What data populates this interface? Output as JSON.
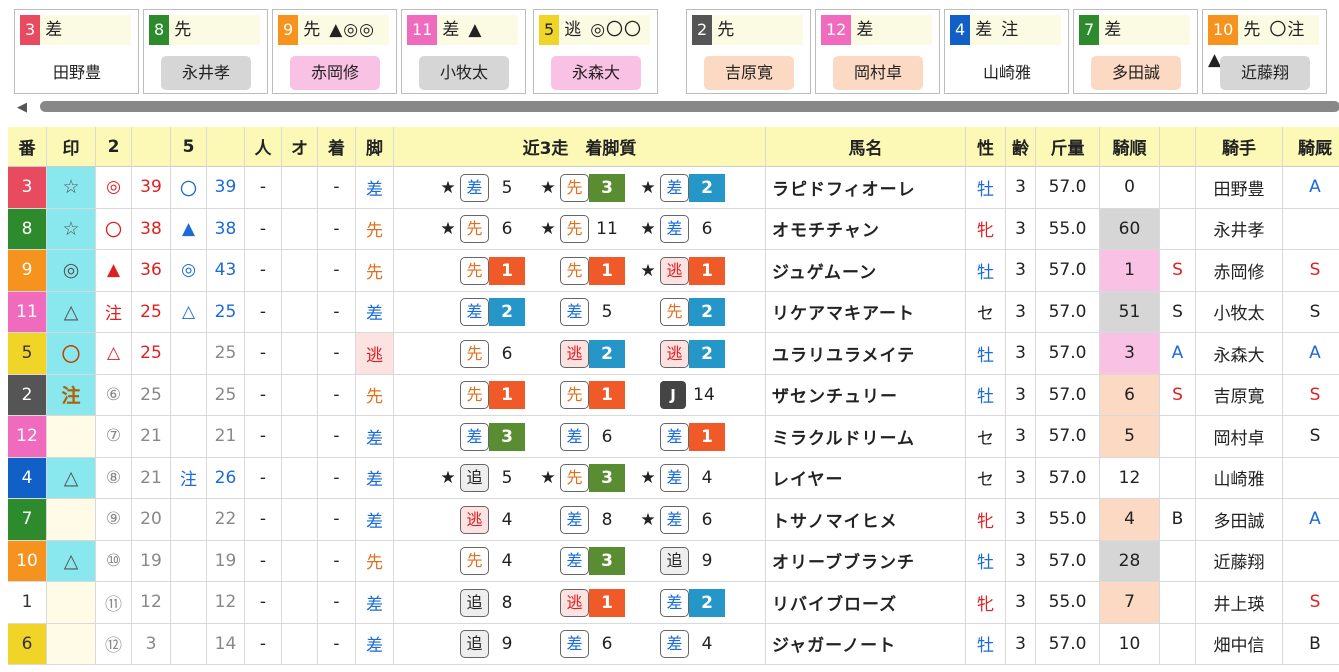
{
  "colors": {
    "w1": "#e84a5f",
    "w2": "#222222",
    "w3": "#e84a5f",
    "w4": "#1060c8",
    "w5": "#f0d428",
    "w6": "#f0d428",
    "w7": "#2d8a2d",
    "w8": "#2d8a2d",
    "w9": "#f5931e",
    "w10": "#f5931e",
    "w11": "#f06bbd",
    "w12": "#f06bbd",
    "gray": "#555555",
    "pink": "#f5a8d6",
    "peach": "#fcd9c2",
    "graybg": "#d6d6d6"
  },
  "cards": [
    {
      "num": "3",
      "style": "差",
      "marks": "",
      "jockey": "田野豊",
      "num_color": "#e84a5f",
      "jk_bg": "#ffffff"
    },
    {
      "num": "8",
      "style": "先",
      "marks": "",
      "jockey": "永井孝",
      "num_color": "#2d8a2d",
      "jk_bg": "#d6d6d6"
    },
    {
      "num": "9",
      "style": "先",
      "marks": "▲◎◎",
      "jockey": "赤岡修",
      "num_color": "#f5931e",
      "jk_bg": "#f9c2e4"
    },
    {
      "num": "11",
      "style": "差",
      "marks": "▲",
      "jockey": "小牧太",
      "num_color": "#f06bbd",
      "jk_bg": "#d6d6d6"
    },
    {
      "num": "5",
      "style": "逃",
      "marks": "◎〇〇",
      "jockey": "永森大",
      "num_color": "#f0d428",
      "jk_bg": "#f9c2e4"
    },
    {
      "num": "2",
      "style": "先",
      "marks": "",
      "jockey": "吉原寛",
      "num_color": "#555555",
      "jk_bg": "#fcd9c2"
    },
    {
      "num": "12",
      "style": "差",
      "marks": "",
      "jockey": "岡村卓",
      "num_color": "#f06bbd",
      "jk_bg": "#fcd9c2"
    },
    {
      "num": "4",
      "style": "差",
      "marks": "注",
      "jockey": "山崎雅",
      "num_color": "#1060c8",
      "jk_bg": "#ffffff"
    },
    {
      "num": "7",
      "style": "差",
      "marks": "",
      "jockey": "多田誠",
      "num_color": "#2d8a2d",
      "jk_bg": "#fcd9c2"
    },
    {
      "num": "10",
      "style": "先",
      "marks": "〇注▲",
      "jockey": "近藤翔",
      "num_color": "#f5931e",
      "jk_bg": "#d6d6d6"
    }
  ],
  "table": {
    "headers": [
      "番",
      "印",
      "2",
      "",
      "5",
      "",
      "人",
      "オ",
      "着",
      "脚",
      "近3走　着脚質",
      "馬名",
      "性",
      "齢",
      "斤量",
      "騎順",
      "",
      "騎手",
      "騎厩"
    ],
    "rows": [
      {
        "num": "3",
        "num_bg": "#e84a5f",
        "mark": "☆",
        "c2m": "◎",
        "c2v": "39",
        "c5m": "〇",
        "c5v": "39",
        "pop": "-",
        "odds": "",
        "fin": "-",
        "leg": "差",
        "leg_cls": "blue",
        "leg_bg": "",
        "runs": [
          {
            "star": "★",
            "st": "差",
            "sc": "b",
            "pos": "5",
            "pc": ""
          },
          {
            "star": "★",
            "st": "先",
            "sc": "o",
            "pos": "3",
            "pc": "p3"
          },
          {
            "star": "★",
            "st": "差",
            "sc": "b",
            "pos": "2",
            "pc": "p2"
          }
        ],
        "horse": "ラピドフィオーレ",
        "sex": "牡",
        "sex_cls": "blue",
        "age": "3",
        "wt": "57.0",
        "jr": "0",
        "jr_bg": "",
        "ja": "",
        "ja_cls": "",
        "jockey": "田野豊",
        "jk": "A",
        "jk_cls": "blue"
      },
      {
        "num": "8",
        "num_bg": "#2d8a2d",
        "mark": "☆",
        "c2m": "〇",
        "c2v": "38",
        "c5m": "▲",
        "c5v": "38",
        "pop": "-",
        "odds": "",
        "fin": "-",
        "leg": "先",
        "leg_cls": "orange",
        "leg_bg": "",
        "runs": [
          {
            "star": "★",
            "st": "先",
            "sc": "o",
            "pos": "6",
            "pc": ""
          },
          {
            "star": "★",
            "st": "先",
            "sc": "o",
            "pos": "11",
            "pc": ""
          },
          {
            "star": "★",
            "st": "差",
            "sc": "b",
            "pos": "6",
            "pc": ""
          }
        ],
        "horse": "オモチチャン",
        "sex": "牝",
        "sex_cls": "red",
        "age": "3",
        "wt": "55.0",
        "jr": "60",
        "jr_bg": "#d6d6d6",
        "ja": "",
        "ja_cls": "",
        "jockey": "永井孝",
        "jk": "",
        "jk_cls": ""
      },
      {
        "num": "9",
        "num_bg": "#f5931e",
        "mark": "◎",
        "c2m": "▲",
        "c2v": "36",
        "c5m": "◎",
        "c5v": "43",
        "pop": "-",
        "odds": "",
        "fin": "-",
        "leg": "先",
        "leg_cls": "orange",
        "leg_bg": "",
        "runs": [
          {
            "star": "",
            "st": "先",
            "sc": "o",
            "pos": "1",
            "pc": "p1"
          },
          {
            "star": "",
            "st": "先",
            "sc": "o",
            "pos": "1",
            "pc": "p1"
          },
          {
            "star": "★",
            "st": "逃",
            "sc": "r",
            "pos": "1",
            "pc": "p1"
          }
        ],
        "horse": "ジュゲムーン",
        "sex": "牡",
        "sex_cls": "blue",
        "age": "3",
        "wt": "57.0",
        "jr": "1",
        "jr_bg": "#f9c2e4",
        "ja": "S",
        "ja_cls": "red",
        "jockey": "赤岡修",
        "jk": "S",
        "jk_cls": "red"
      },
      {
        "num": "11",
        "num_bg": "#f06bbd",
        "mark": "△",
        "c2m": "注",
        "c2v": "25",
        "c5m": "△",
        "c5v": "25",
        "pop": "-",
        "odds": "",
        "fin": "-",
        "leg": "差",
        "leg_cls": "blue",
        "leg_bg": "",
        "runs": [
          {
            "star": "",
            "st": "差",
            "sc": "b",
            "pos": "2",
            "pc": "p2"
          },
          {
            "star": "",
            "st": "差",
            "sc": "b",
            "pos": "5",
            "pc": ""
          },
          {
            "star": "",
            "st": "先",
            "sc": "o",
            "pos": "2",
            "pc": "p2"
          }
        ],
        "horse": "リケアマキアート",
        "sex": "セ",
        "sex_cls": "",
        "age": "3",
        "wt": "57.0",
        "jr": "51",
        "jr_bg": "#d6d6d6",
        "ja": "S",
        "ja_cls": "",
        "jockey": "小牧太",
        "jk": "S",
        "jk_cls": ""
      },
      {
        "num": "5",
        "num_bg": "#f0d428",
        "mark": "〇",
        "c2m": "△",
        "c2v": "25",
        "c5m": "",
        "c5v": "25",
        "pop": "-",
        "odds": "",
        "fin": "-",
        "leg": "逃",
        "leg_cls": "red",
        "leg_bg": "#fde2e2",
        "runs": [
          {
            "star": "",
            "st": "先",
            "sc": "o",
            "pos": "6",
            "pc": ""
          },
          {
            "star": "",
            "st": "逃",
            "sc": "r",
            "pos": "2",
            "pc": "p2"
          },
          {
            "star": "",
            "st": "逃",
            "sc": "r",
            "pos": "2",
            "pc": "p2"
          }
        ],
        "horse": "ユラリユラメイテ",
        "sex": "牡",
        "sex_cls": "blue",
        "age": "3",
        "wt": "57.0",
        "jr": "3",
        "jr_bg": "#f9c2e4",
        "ja": "A",
        "ja_cls": "blue",
        "jockey": "永森大",
        "jk": "A",
        "jk_cls": "blue"
      },
      {
        "num": "2",
        "num_bg": "#555555",
        "mark": "注",
        "c2m": "⑥",
        "c2v": "25",
        "c5m": "",
        "c5v": "25",
        "pop": "-",
        "odds": "",
        "fin": "-",
        "leg": "先",
        "leg_cls": "orange",
        "leg_bg": "",
        "runs": [
          {
            "star": "",
            "st": "先",
            "sc": "o",
            "pos": "1",
            "pc": "p1"
          },
          {
            "star": "",
            "st": "先",
            "sc": "o",
            "pos": "1",
            "pc": "p1"
          },
          {
            "star": "",
            "st": "J",
            "sc": "j",
            "pos": "14",
            "pc": ""
          }
        ],
        "horse": "ザセンチュリー",
        "sex": "牡",
        "sex_cls": "blue",
        "age": "3",
        "wt": "57.0",
        "jr": "6",
        "jr_bg": "#fcd9c2",
        "ja": "S",
        "ja_cls": "red",
        "jockey": "吉原寛",
        "jk": "S",
        "jk_cls": "red"
      },
      {
        "num": "12",
        "num_bg": "#f06bbd",
        "mark": "",
        "c2m": "⑦",
        "c2v": "21",
        "c5m": "",
        "c5v": "21",
        "pop": "-",
        "odds": "",
        "fin": "-",
        "leg": "差",
        "leg_cls": "blue",
        "leg_bg": "",
        "runs": [
          {
            "star": "",
            "st": "差",
            "sc": "b",
            "pos": "3",
            "pc": "p3"
          },
          {
            "star": "",
            "st": "差",
            "sc": "b",
            "pos": "6",
            "pc": ""
          },
          {
            "star": "",
            "st": "差",
            "sc": "b",
            "pos": "1",
            "pc": "p1"
          }
        ],
        "horse": "ミラクルドリーム",
        "sex": "セ",
        "sex_cls": "",
        "age": "3",
        "wt": "57.0",
        "jr": "5",
        "jr_bg": "#fcd9c2",
        "ja": "",
        "ja_cls": "",
        "jockey": "岡村卓",
        "jk": "S",
        "jk_cls": ""
      },
      {
        "num": "4",
        "num_bg": "#1060c8",
        "mark": "△",
        "c2m": "⑧",
        "c2v": "21",
        "c5m": "注",
        "c5v": "26",
        "pop": "-",
        "odds": "",
        "fin": "-",
        "leg": "差",
        "leg_cls": "blue",
        "leg_bg": "",
        "runs": [
          {
            "star": "★",
            "st": "追",
            "sc": "k",
            "pos": "5",
            "pc": ""
          },
          {
            "star": "★",
            "st": "先",
            "sc": "o",
            "pos": "3",
            "pc": "p3"
          },
          {
            "star": "★",
            "st": "差",
            "sc": "b",
            "pos": "4",
            "pc": ""
          }
        ],
        "horse": "レイヤー",
        "sex": "セ",
        "sex_cls": "",
        "age": "3",
        "wt": "57.0",
        "jr": "12",
        "jr_bg": "",
        "ja": "",
        "ja_cls": "",
        "jockey": "山崎雅",
        "jk": "",
        "jk_cls": ""
      },
      {
        "num": "7",
        "num_bg": "#2d8a2d",
        "mark": "",
        "c2m": "⑨",
        "c2v": "20",
        "c5m": "",
        "c5v": "22",
        "pop": "-",
        "odds": "",
        "fin": "-",
        "leg": "差",
        "leg_cls": "blue",
        "leg_bg": "",
        "runs": [
          {
            "star": "",
            "st": "逃",
            "sc": "r",
            "pos": "4",
            "pc": ""
          },
          {
            "star": "",
            "st": "差",
            "sc": "b",
            "pos": "8",
            "pc": ""
          },
          {
            "star": "★",
            "st": "差",
            "sc": "b",
            "pos": "6",
            "pc": ""
          }
        ],
        "horse": "トサノマイヒメ",
        "sex": "牝",
        "sex_cls": "red",
        "age": "3",
        "wt": "55.0",
        "jr": "4",
        "jr_bg": "#fcd9c2",
        "ja": "B",
        "ja_cls": "",
        "jockey": "多田誠",
        "jk": "A",
        "jk_cls": "blue"
      },
      {
        "num": "10",
        "num_bg": "#f5931e",
        "mark": "△",
        "c2m": "⑩",
        "c2v": "19",
        "c5m": "",
        "c5v": "19",
        "pop": "-",
        "odds": "",
        "fin": "-",
        "leg": "先",
        "leg_cls": "orange",
        "leg_bg": "",
        "runs": [
          {
            "star": "",
            "st": "先",
            "sc": "o",
            "pos": "4",
            "pc": ""
          },
          {
            "star": "",
            "st": "差",
            "sc": "b",
            "pos": "3",
            "pc": "p3"
          },
          {
            "star": "",
            "st": "追",
            "sc": "k",
            "pos": "9",
            "pc": ""
          }
        ],
        "horse": "オリーブブランチ",
        "sex": "牡",
        "sex_cls": "blue",
        "age": "3",
        "wt": "57.0",
        "jr": "28",
        "jr_bg": "#d6d6d6",
        "ja": "",
        "ja_cls": "",
        "jockey": "近藤翔",
        "jk": "",
        "jk_cls": ""
      },
      {
        "num": "1",
        "num_bg": "#ffffff",
        "mark": "",
        "c2m": "⑪",
        "c2v": "12",
        "c5m": "",
        "c5v": "12",
        "pop": "-",
        "odds": "",
        "fin": "-",
        "leg": "差",
        "leg_cls": "blue",
        "leg_bg": "",
        "runs": [
          {
            "star": "",
            "st": "追",
            "sc": "k",
            "pos": "8",
            "pc": ""
          },
          {
            "star": "",
            "st": "逃",
            "sc": "r",
            "pos": "1",
            "pc": "p1"
          },
          {
            "star": "",
            "st": "差",
            "sc": "b",
            "pos": "2",
            "pc": "p2"
          }
        ],
        "horse": "リバイブローズ",
        "sex": "牝",
        "sex_cls": "red",
        "age": "3",
        "wt": "55.0",
        "jr": "7",
        "jr_bg": "#fcd9c2",
        "ja": "",
        "ja_cls": "",
        "jockey": "井上瑛",
        "jk": "S",
        "jk_cls": "red"
      },
      {
        "num": "6",
        "num_bg": "#f0d428",
        "mark": "",
        "c2m": "⑫",
        "c2v": "3",
        "c5m": "",
        "c5v": "14",
        "pop": "-",
        "odds": "",
        "fin": "-",
        "leg": "差",
        "leg_cls": "blue",
        "leg_bg": "",
        "runs": [
          {
            "star": "",
            "st": "追",
            "sc": "k",
            "pos": "9",
            "pc": ""
          },
          {
            "star": "",
            "st": "差",
            "sc": "b",
            "pos": "6",
            "pc": ""
          },
          {
            "star": "",
            "st": "差",
            "sc": "b",
            "pos": "4",
            "pc": ""
          }
        ],
        "horse": "ジャガーノート",
        "sex": "牡",
        "sex_cls": "blue",
        "age": "3",
        "wt": "57.0",
        "jr": "10",
        "jr_bg": "",
        "ja": "",
        "ja_cls": "",
        "jockey": "畑中信",
        "jk": "B",
        "jk_cls": ""
      }
    ]
  }
}
